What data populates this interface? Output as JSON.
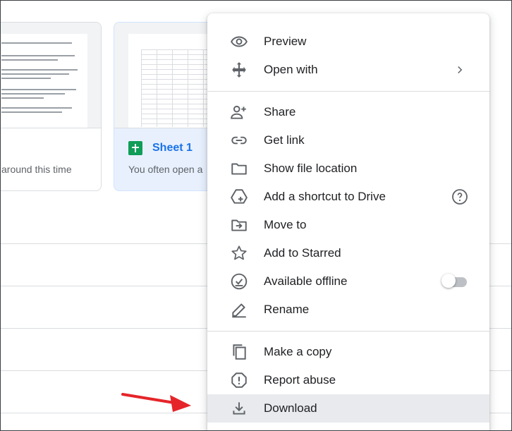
{
  "cards": {
    "left": {
      "subtitle": "around this time"
    },
    "right": {
      "title": "Sheet 1",
      "subtitle": "You often open a"
    }
  },
  "menu": {
    "items": [
      {
        "label": "Preview",
        "icon": "eye-icon"
      },
      {
        "label": "Open with",
        "icon": "move-arrows-icon",
        "has_submenu": true
      },
      {
        "label": "Share",
        "icon": "person-add-icon"
      },
      {
        "label": "Get link",
        "icon": "link-icon"
      },
      {
        "label": "Show file location",
        "icon": "folder-icon"
      },
      {
        "label": "Add a shortcut to Drive",
        "icon": "drive-shortcut-icon",
        "has_help": true
      },
      {
        "label": "Move to",
        "icon": "folder-move-icon"
      },
      {
        "label": "Add to Starred",
        "icon": "star-icon"
      },
      {
        "label": "Available offline",
        "icon": "offline-check-icon",
        "toggle": false
      },
      {
        "label": "Rename",
        "icon": "pencil-icon"
      },
      {
        "label": "Make a copy",
        "icon": "copy-icon"
      },
      {
        "label": "Report abuse",
        "icon": "report-icon"
      },
      {
        "label": "Download",
        "icon": "download-icon",
        "highlighted": true
      }
    ]
  },
  "colors": {
    "accent": "#1a73e8",
    "sheets_green": "#0f9d58",
    "hover": "#e8eaed",
    "annotation_arrow": "#e5252a"
  }
}
